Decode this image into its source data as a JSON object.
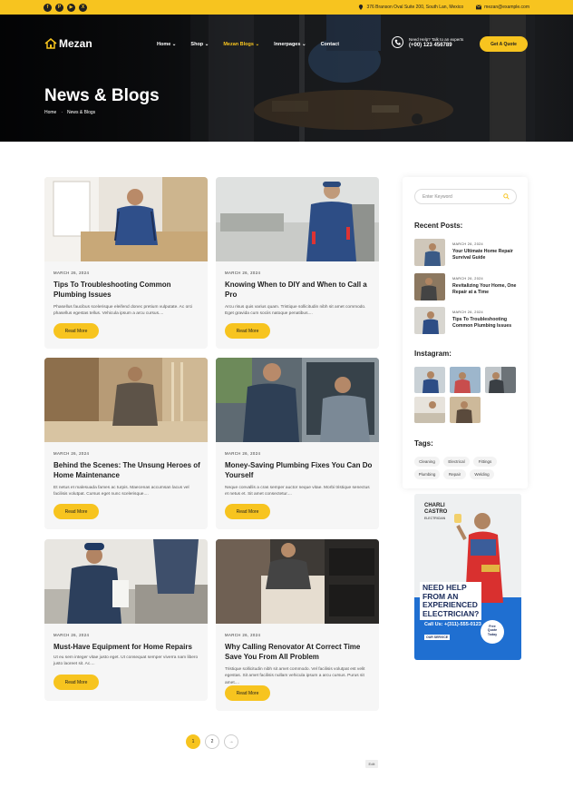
{
  "topbar": {
    "social": [
      "f",
      "P",
      "▶",
      "X"
    ],
    "address": "376 Branson Oval Suite 200, South Lan, Mexico",
    "email": "mezan@example.com"
  },
  "header": {
    "logo_text": "Mezan",
    "nav": [
      "Home",
      "Shop",
      "Mezan Blogs",
      "Innerpages",
      "Contact"
    ],
    "help_label": "Need Help? Talk to an experts",
    "help_phone": "(+00) 123 456789",
    "quote_button": "Get A Quote"
  },
  "hero": {
    "title": "News & Blogs",
    "breadcrumb": [
      "Home",
      "News & Blogs"
    ]
  },
  "posts": [
    {
      "date": "MARCH 26, 2024",
      "title": "Tips To Troubleshooting Common Plumbing Issues",
      "excerpt": "Phasellus faucibus scelerisque eleifend donec pretium vulputate. Ac orci phasellus egestas tellus. Vehicula ipsum a arcu cursus....",
      "button": "Read More"
    },
    {
      "date": "MARCH 26, 2024",
      "title": "Knowing When to DIY and When to Call a Pro",
      "excerpt": "Arcu risus quis varius quam. Tristique sollicitudin nibh sit amet commodo. Eget gravida cum sociis natoque penatibus....",
      "button": "Read More"
    },
    {
      "date": "MARCH 26, 2024",
      "title": "Behind the Scenes: The Unsung Heroes of Home Maintenance",
      "excerpt": "Et netus et malesuada fames ac turpis. Maecenas accumsan lacus vel facilisis volutpat. Cursus eget nunc scelerisque....",
      "button": "Read More"
    },
    {
      "date": "MARCH 26, 2024",
      "title": "Money-Saving Plumbing Fixes You Can Do Yourself",
      "excerpt": "Neque convallis a cras semper auctor neque vitae. Morbi tristique senectus et netus et. Sit amet consectetur....",
      "button": "Read More"
    },
    {
      "date": "MARCH 26, 2024",
      "title": "Must-Have Equipment for Home Repairs",
      "excerpt": "Ut eu sem integer vitae justo eget. Ut consequat semper viverra nam libero justo laoreet sit. Ac....",
      "button": "Read More"
    },
    {
      "date": "MARCH 26, 2024",
      "title": "Why Calling Renovator At Correct Time Save You From All Problem",
      "excerpt": "Tristique sollicitudin nibh sit amet commodo. Vel facilisis volutpat est velit egestas. Sit amet facilisis nullam vehicula ipsum a arcu cursus. Purus sit amet....",
      "button": "Read More"
    }
  ],
  "sidebar": {
    "search_placeholder": "Enter Keyword",
    "recent_heading": "Recent Posts:",
    "recent": [
      {
        "date": "MARCH 26, 2024",
        "title": "Your Ultimate Home Repair Survival Guide"
      },
      {
        "date": "MARCH 26, 2024",
        "title": "Revitalizing Your Home, One Repair at a Time"
      },
      {
        "date": "MARCH 26, 2024",
        "title": "Tips To Troubleshooting Common Plumbing Issues"
      }
    ],
    "instagram_heading": "Instagram:",
    "tags_heading": "Tags:",
    "tags": [
      "Cleaning",
      "Electrical",
      "Fittings",
      "Plumbing",
      "Repair",
      "Welding"
    ]
  },
  "ad": {
    "brand_line1": "CHARLI",
    "brand_line2": "CASTRO",
    "brand_sub": "ELECTRICIAN",
    "headline_1": "NEED HELP",
    "headline_2": "FROM AN",
    "headline_3": "EXPERIENCED",
    "headline_4": "ELECTRICIAN?",
    "call": "Call Us: +(311)-555-0123",
    "service_label": "OUR SERVICE",
    "badge_1": "Free",
    "badge_2": "Quote",
    "badge_3": "Today"
  },
  "pagination": {
    "pages": [
      "1",
      "2"
    ],
    "next": "→"
  },
  "edit_label": "Edit",
  "colors": {
    "accent": "#f7c41f",
    "dark": "#1e1e1e",
    "card_bg": "#f6f6f6",
    "ad_blue": "#1f6fd1"
  }
}
